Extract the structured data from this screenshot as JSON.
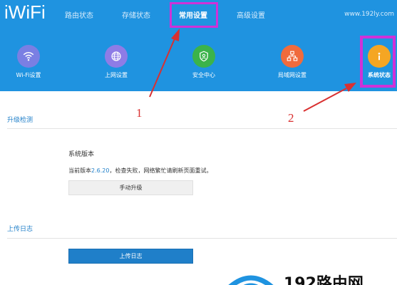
{
  "header": {
    "logo": "iWiFi",
    "tabs": [
      {
        "label": "路由状态"
      },
      {
        "label": "存储状态"
      },
      {
        "label": "常用设置"
      },
      {
        "label": "高级设置"
      }
    ],
    "site_url": "www.192ly.com"
  },
  "menu": [
    {
      "label": "Wi-Fi设置",
      "icon": "wifi-icon",
      "color": "#7a7fe3"
    },
    {
      "label": "上网设置",
      "icon": "globe-icon",
      "color": "#8e7ce6"
    },
    {
      "label": "安全中心",
      "icon": "shield-icon",
      "color": "#3bb34a"
    },
    {
      "label": "局域网设置",
      "icon": "network-icon",
      "color": "#f06b3c"
    },
    {
      "label": "系统状态",
      "icon": "info-icon",
      "color": "#f5a623"
    }
  ],
  "upgrade": {
    "title": "升级检测",
    "sys_version_label": "系统版本",
    "current_prefix": "当前版本",
    "version": "2.6.20",
    "status_msg": "，检查失败，网络繁忙请刷新页面重试。",
    "button": "手动升级"
  },
  "log": {
    "title": "上传日志",
    "button": "上传日志"
  },
  "annotations": {
    "one": "1",
    "two": "2"
  },
  "watermark": {
    "text": "192路由网"
  },
  "colors": {
    "header_bg": "#1f93e0",
    "highlight": "#cf31d8",
    "annotation": "#d93030",
    "primary_button": "#1f7fc9"
  }
}
